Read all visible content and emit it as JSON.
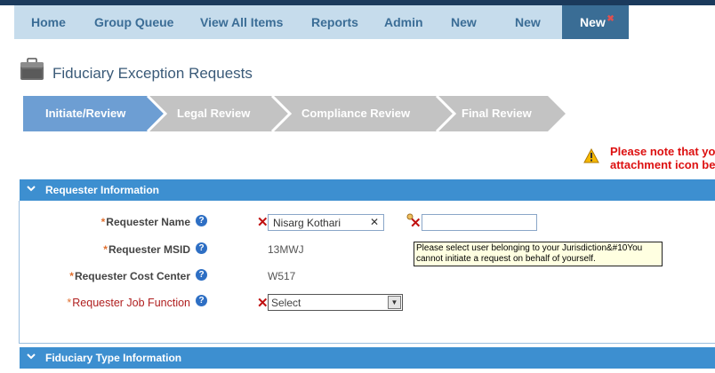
{
  "nav": {
    "items": [
      {
        "label": "Home"
      },
      {
        "label": "Group Queue"
      },
      {
        "label": "View All Items"
      },
      {
        "label": "Reports"
      },
      {
        "label": "Admin"
      },
      {
        "label": "New"
      },
      {
        "label": "New"
      },
      {
        "label": "New",
        "active": true
      }
    ]
  },
  "page": {
    "title": "Fiduciary Exception Requests"
  },
  "workflow": {
    "steps": [
      {
        "label": "Initiate/Review",
        "active": true
      },
      {
        "label": "Legal Review"
      },
      {
        "label": "Compliance Review"
      },
      {
        "label": "Final Review"
      }
    ]
  },
  "notice": {
    "line1": "Please note that yo",
    "line2": "attachment icon be"
  },
  "requester": {
    "header": "Requester Information",
    "name": {
      "label": "Requester Name",
      "value": "Nisarg Kothari"
    },
    "msid": {
      "label": "Requester MSID",
      "value": "13MWJ"
    },
    "cost_center": {
      "label": "Requester Cost Center",
      "value": "W517"
    },
    "job_function": {
      "label": "Requester Job Function",
      "selected": "Select"
    },
    "tooltip": "Please select user belonging to your Jurisdiction&#10You cannot initiate a request on behalf of yourself."
  },
  "fiduciary": {
    "header": "Fiduciary Type Information"
  },
  "colors": {
    "nav_bg": "#c6dcec",
    "nav_active": "#3a6d95",
    "panel_header": "#3d8fd0",
    "step_active": "#6d9ed3",
    "step_inactive": "#c3c3c3",
    "notice_text": "#dd1111"
  }
}
